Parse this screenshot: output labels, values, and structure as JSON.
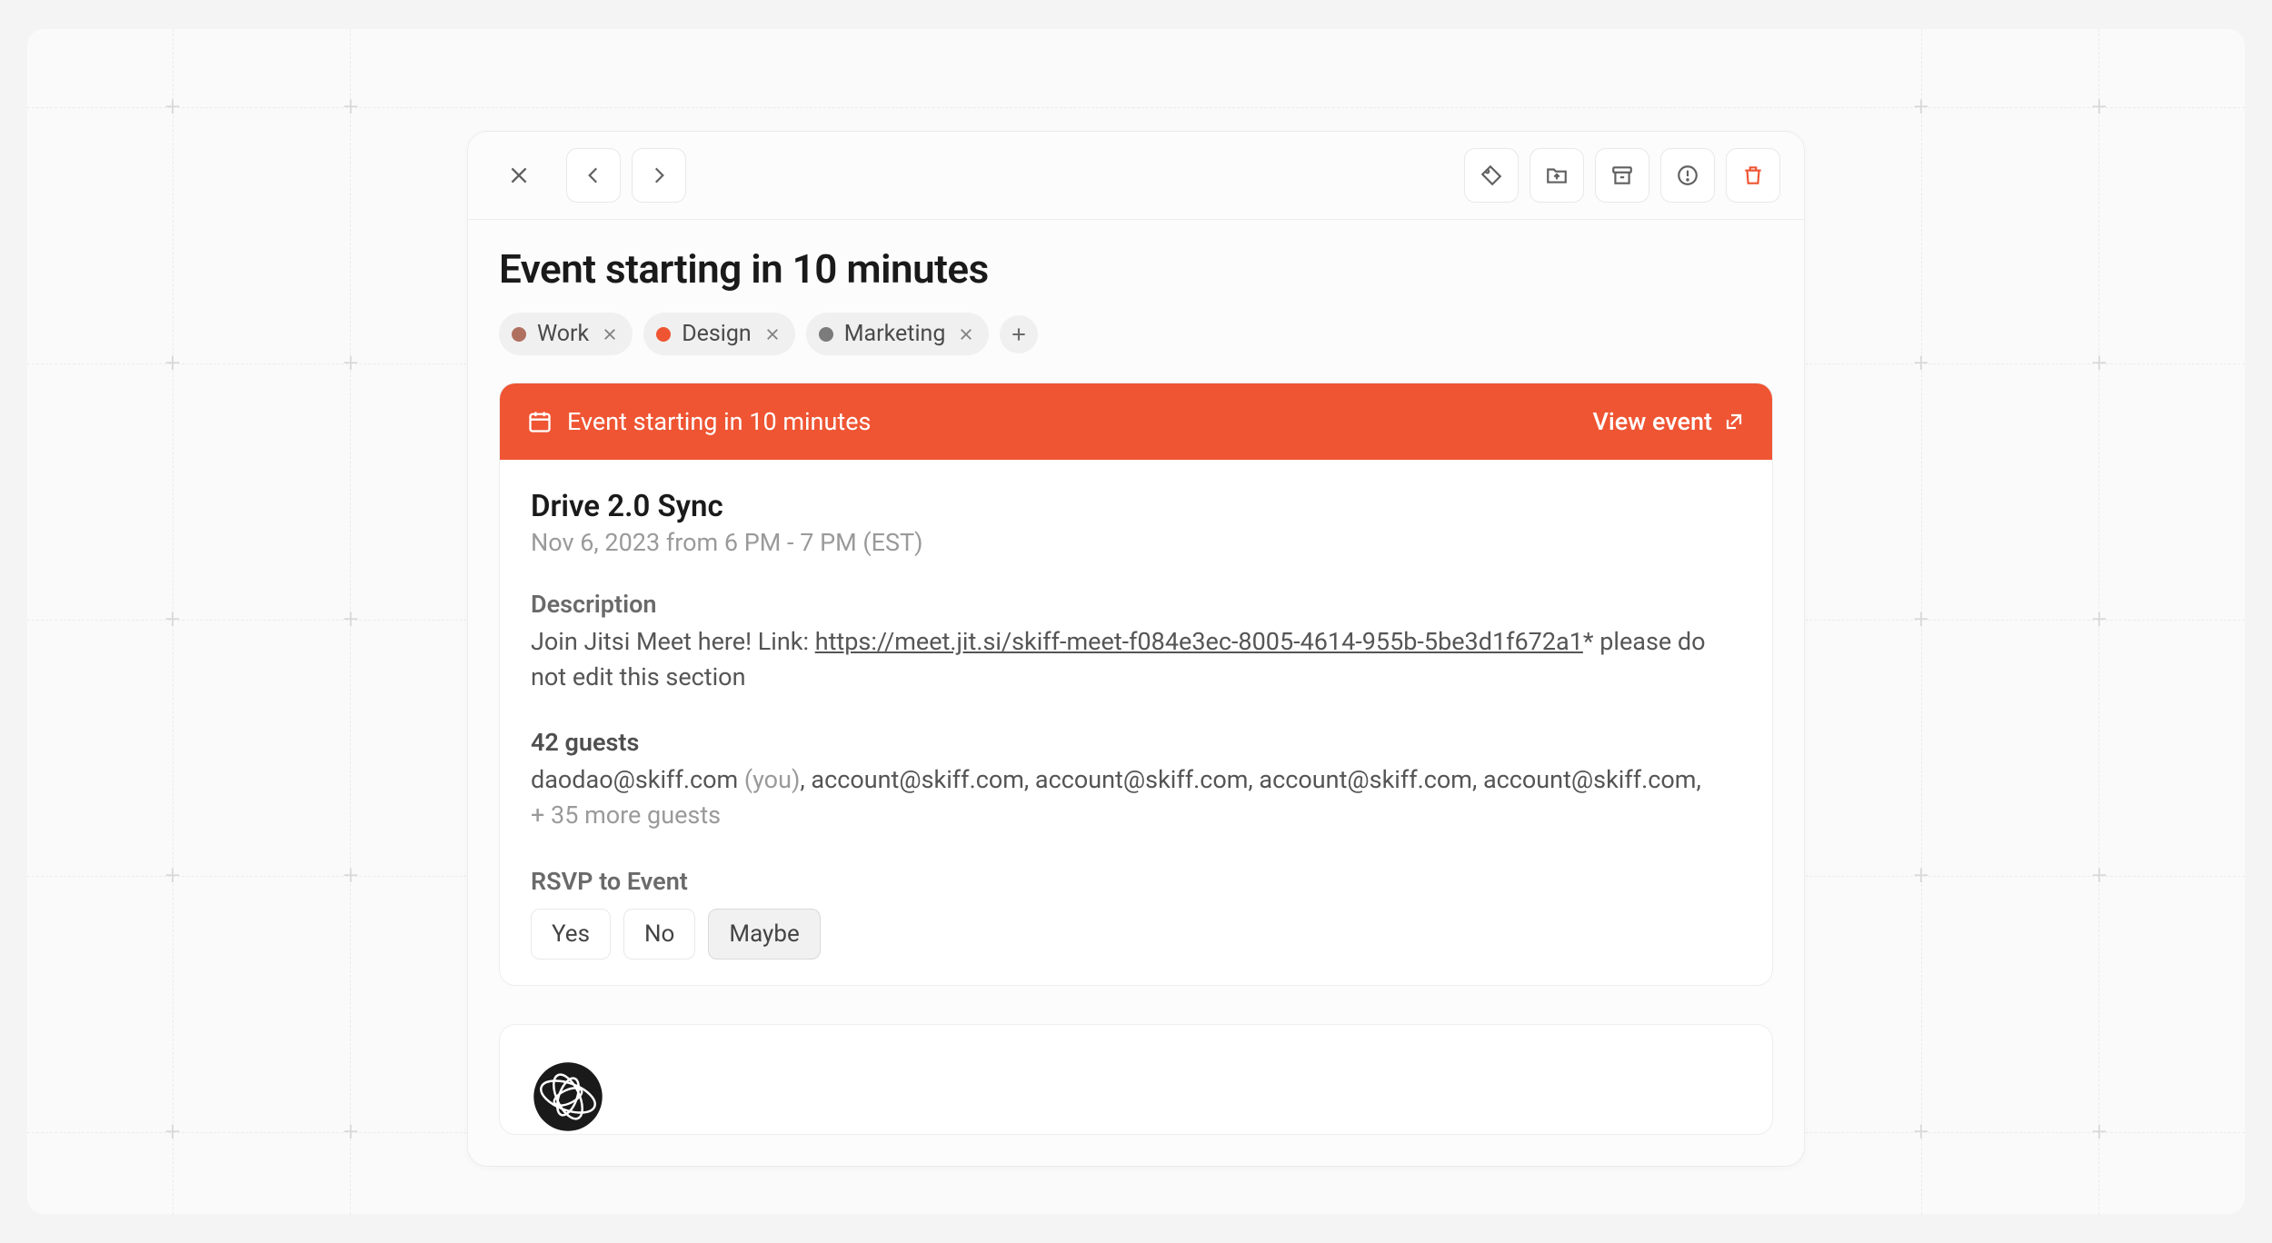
{
  "page_title": "Event starting in 10 minutes",
  "tags": [
    {
      "label": "Work",
      "color": "brown"
    },
    {
      "label": "Design",
      "color": "red"
    },
    {
      "label": "Marketing",
      "color": "gray"
    }
  ],
  "banner": {
    "text": "Event starting in 10 minutes",
    "action": "View event"
  },
  "event": {
    "title": "Drive 2.0 Sync",
    "time": "Nov 6, 2023 from 6 PM - 7 PM (EST)",
    "description_label": "Description",
    "description_prefix": "Join Jitsi Meet here! Link: ",
    "description_link": "https://meet.jit.si/skiff-meet-f084e3ec-8005-4614-955b-5be3d1f672a1",
    "description_suffix": "* please do not edit this section",
    "guests_label": "42 guests",
    "guests_self": "daodao@skiff.com",
    "guests_you_marker": "(you)",
    "guests_rest": "account@skiff.com, account@skiff.com, account@skiff.com, account@skiff.com,",
    "guests_more": "+ 35 more guests",
    "rsvp_label": "RSVP to Event",
    "rsvp_options": {
      "yes": "Yes",
      "no": "No",
      "maybe": "Maybe"
    },
    "rsvp_selected": "maybe"
  }
}
